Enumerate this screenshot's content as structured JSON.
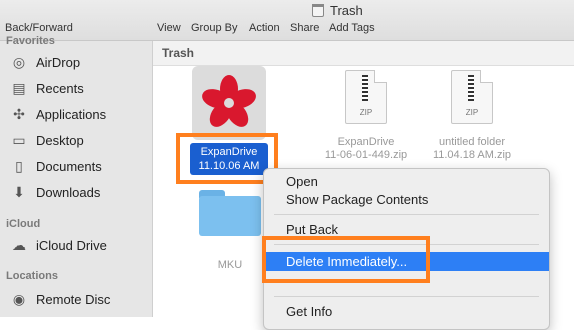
{
  "window": {
    "title": "Trash"
  },
  "toolbar": {
    "back_forward": "Back/Forward",
    "view": "View",
    "group_by": "Group By",
    "action": "Action",
    "share": "Share",
    "add_tags": "Add Tags"
  },
  "sidebar": {
    "favorites_heading": "Favorites",
    "favorites": [
      {
        "label": "AirDrop",
        "icon": "airdrop-icon"
      },
      {
        "label": "Recents",
        "icon": "recents-icon"
      },
      {
        "label": "Applications",
        "icon": "applications-icon"
      },
      {
        "label": "Desktop",
        "icon": "desktop-icon"
      },
      {
        "label": "Documents",
        "icon": "documents-icon"
      },
      {
        "label": "Downloads",
        "icon": "downloads-icon"
      }
    ],
    "icloud_heading": "iCloud",
    "icloud": [
      {
        "label": "iCloud Drive",
        "icon": "icloud-icon"
      }
    ],
    "locations_heading": "Locations",
    "locations": [
      {
        "label": "Remote Disc",
        "icon": "disc-icon"
      }
    ]
  },
  "path_bar": {
    "label": "Trash"
  },
  "files": {
    "selected": {
      "line1": "ExpanDrive",
      "line2": "11.10.06 AM"
    },
    "zip1": {
      "type_label": "ZIP",
      "name1": "ExpanDrive",
      "name2": "11-06-01-449.zip"
    },
    "zip2": {
      "type_label": "ZIP",
      "name1": "untitled folder",
      "name2": "11.04.18 AM.zip"
    },
    "folder": {
      "name": "MKU"
    }
  },
  "context_menu": {
    "items": {
      "open": "Open",
      "show_package": "Show Package Contents",
      "put_back": "Put Back",
      "delete_immediately": "Delete Immediately...",
      "get_info": "Get Info"
    }
  },
  "colors": {
    "highlight": "#ff7f1e",
    "selection": "#1a5fd0",
    "menu_active": "#2d7ff5"
  }
}
